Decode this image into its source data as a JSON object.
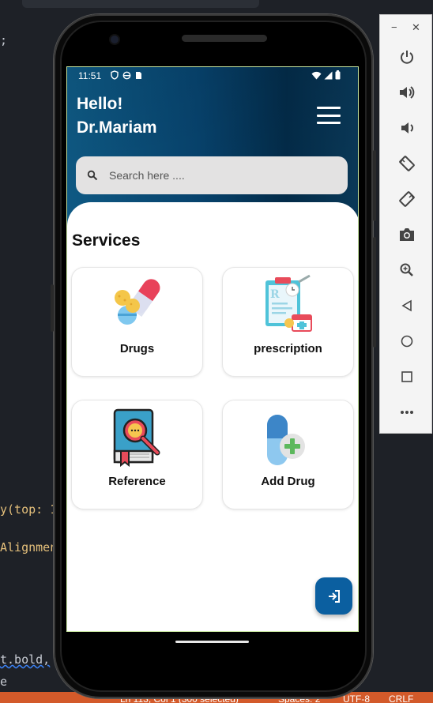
{
  "ide": {
    "code_fragments": [
      ";",
      "y(top: 1",
      "Alignmen",
      "t.bold,",
      "e"
    ],
    "status_bar": {
      "cursor": "Ln 113, Col 1 (300 selected)",
      "spaces": "Spaces: 2",
      "encoding": "UTF-8",
      "eol": "CRLF"
    },
    "colors": {
      "status_bar": "#d35a2a",
      "background": "#1e2127"
    }
  },
  "device_status": {
    "time": "11:51",
    "left_icons": [
      "vpn-shield-icon",
      "sync-icon",
      "sim-card-icon"
    ],
    "right_icons": [
      "wifi-icon",
      "signal-icon",
      "battery-icon"
    ]
  },
  "app": {
    "greeting_line1": "Hello!",
    "greeting_line2": "Dr.Mariam",
    "search_placeholder": "Search here ....",
    "section_title": "Services",
    "services": [
      {
        "label": "Drugs",
        "icon": "pills-icon"
      },
      {
        "label": "prescription",
        "icon": "prescription-clipboard-icon"
      },
      {
        "label": "Reference",
        "icon": "book-magnifier-icon"
      },
      {
        "label": "Add Drug",
        "icon": "capsule-plus-icon"
      }
    ],
    "fab_icon": "login-icon",
    "colors": {
      "header_start": "#0f5b86",
      "header_end": "#032c4a",
      "fab": "#0b5fa0",
      "search_bg": "#e3e2e2"
    }
  },
  "emulator_toolbar": {
    "window_controls": [
      "minimize",
      "close"
    ],
    "buttons": [
      "power",
      "volume-up",
      "volume-down",
      "rotate-left",
      "rotate-right",
      "screenshot",
      "zoom",
      "back",
      "home",
      "overview",
      "more"
    ]
  }
}
